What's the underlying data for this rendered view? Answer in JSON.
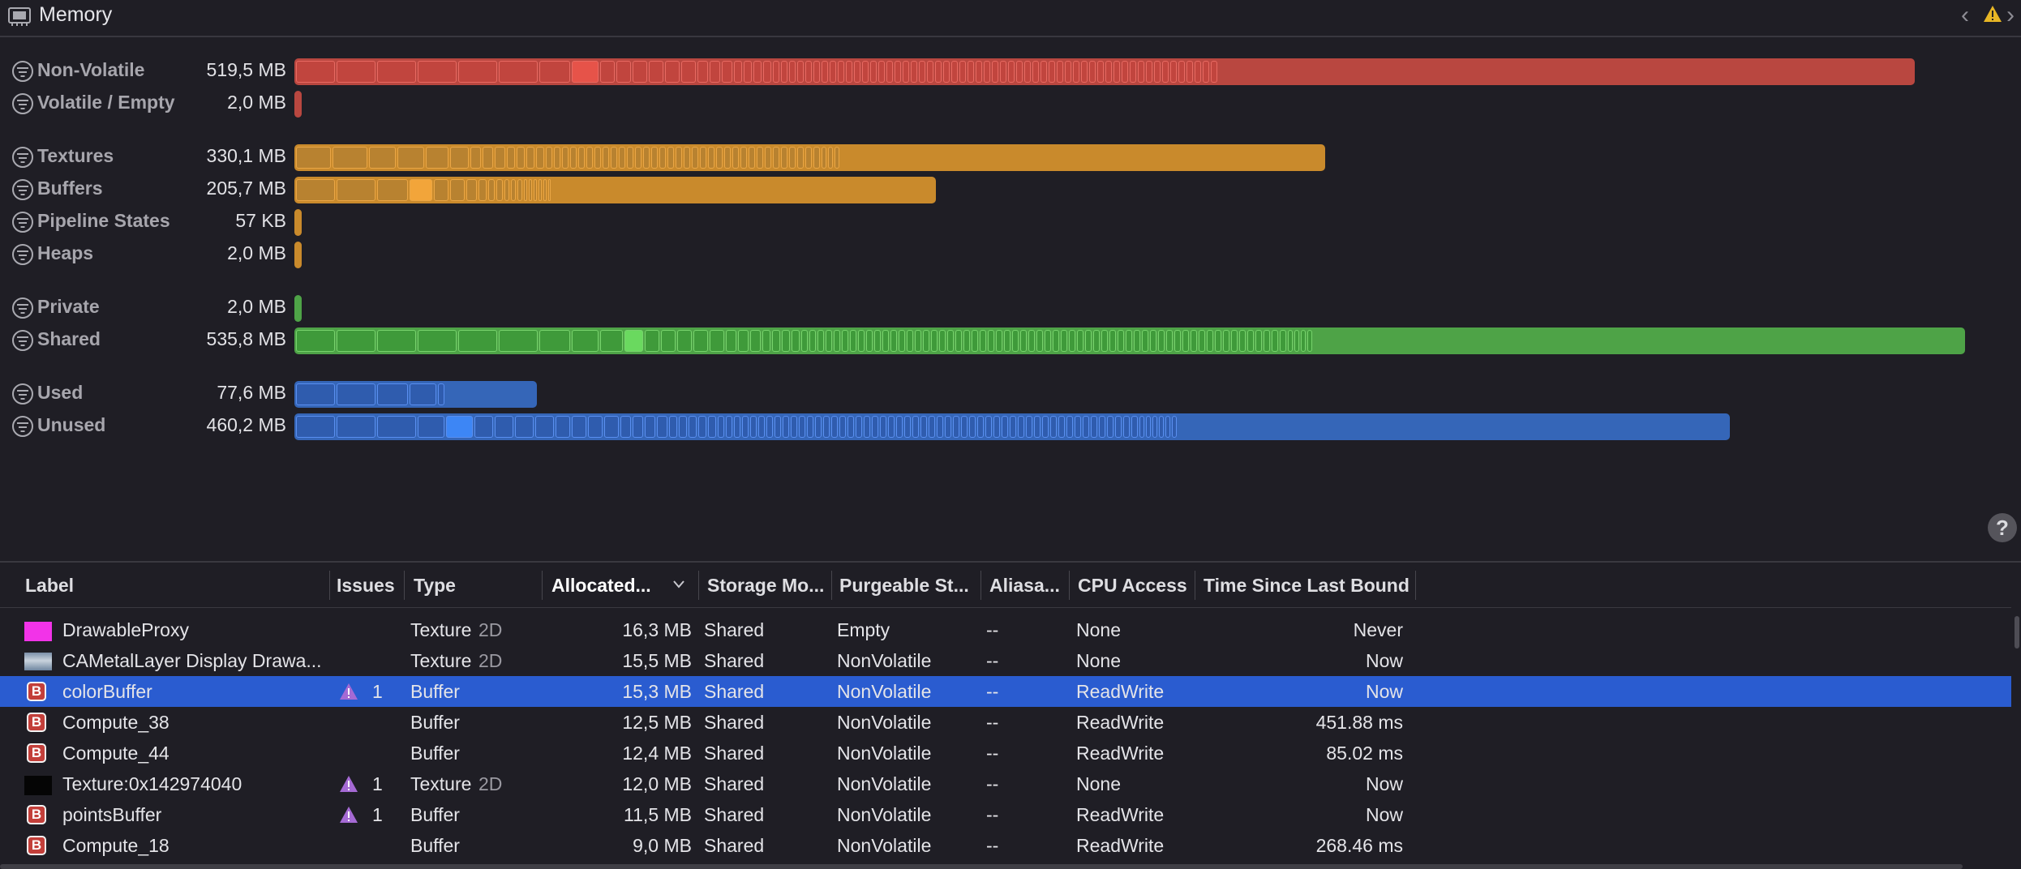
{
  "window": {
    "title": "Memory",
    "back_icon": "chevron-left-icon",
    "forward_icon": "chevron-right-icon",
    "issue_icon": "warning-icon"
  },
  "memory_rows": [
    {
      "key": "nonvolatile",
      "label": "Non-Volatile",
      "size": "519,5 MB",
      "bar_fraction": 0.97,
      "color": "#b94740",
      "segments": [
        50,
        50,
        50,
        50,
        50,
        50,
        40,
        35,
        20,
        20,
        20,
        20,
        20,
        20,
        15,
        15,
        15,
        12,
        12,
        12,
        12,
        10,
        10,
        10,
        10,
        10,
        10,
        10,
        10,
        10,
        10,
        10,
        10,
        10,
        10,
        10,
        10,
        10,
        10,
        10,
        10,
        10,
        10,
        10,
        10,
        10,
        10,
        10,
        10,
        10,
        10,
        10,
        10,
        10,
        10,
        10,
        10,
        10,
        10,
        10,
        10,
        10,
        10,
        10,
        10,
        10,
        10,
        10,
        10,
        10,
        10,
        10,
        10,
        10,
        10,
        10
      ],
      "highlight": 7
    },
    {
      "key": "volatile",
      "label": "Volatile / Empty",
      "size": "2,0 MB",
      "bar_fraction": 0.004,
      "color": "#b94740",
      "segments": [],
      "highlight": -1
    },
    {
      "key": "textures",
      "label": "Textures",
      "size": "330,1 MB",
      "bar_fraction": 0.617,
      "color": "#c98a2c",
      "segments": [
        45,
        45,
        35,
        35,
        30,
        25,
        15,
        15,
        15,
        12,
        12,
        12,
        12,
        10,
        10,
        10,
        10,
        10,
        10,
        10,
        10,
        10,
        10,
        10,
        10,
        10,
        10,
        10,
        10,
        10,
        10,
        10,
        10,
        10,
        10,
        10,
        10,
        10,
        10,
        10,
        10,
        10,
        10,
        10,
        10,
        10,
        10,
        8,
        8,
        8
      ],
      "highlight": -1
    },
    {
      "key": "buffers",
      "label": "Buffers",
      "size": "205,7 MB",
      "bar_fraction": 0.384,
      "color": "#c98a2c",
      "segments": [
        50,
        50,
        40,
        30,
        20,
        20,
        15,
        12,
        10,
        10,
        8,
        8,
        8,
        6,
        6,
        6,
        6,
        6,
        5
      ],
      "highlight": 3
    },
    {
      "key": "pipeline",
      "label": "Pipeline States",
      "size": "57 KB",
      "bar_fraction": 0.004,
      "color": "#c98a2c",
      "segments": [],
      "highlight": -1
    },
    {
      "key": "heaps",
      "label": "Heaps",
      "size": "2,0 MB",
      "bar_fraction": 0.004,
      "color": "#c98a2c",
      "segments": [],
      "highlight": -1
    },
    {
      "key": "private",
      "label": "Private",
      "size": "2,0 MB",
      "bar_fraction": 0.004,
      "color": "#4ea347",
      "segments": [],
      "highlight": -1
    },
    {
      "key": "shared",
      "label": "Shared",
      "size": "535,8 MB",
      "bar_fraction": 1.0,
      "color": "#4ea347",
      "segments": [
        50,
        50,
        50,
        50,
        50,
        50,
        40,
        35,
        30,
        25,
        20,
        20,
        20,
        20,
        20,
        15,
        15,
        15,
        12,
        12,
        12,
        12,
        10,
        10,
        10,
        10,
        10,
        10,
        10,
        10,
        10,
        10,
        10,
        10,
        10,
        10,
        10,
        10,
        10,
        10,
        10,
        10,
        10,
        10,
        10,
        10,
        10,
        10,
        10,
        10,
        10,
        10,
        10,
        10,
        10,
        10,
        10,
        10,
        10,
        10,
        10,
        10,
        10,
        10,
        10,
        10,
        10,
        10,
        10,
        10,
        10,
        10,
        10,
        10,
        10,
        10,
        10,
        10,
        10,
        10,
        10,
        10,
        8,
        8,
        8,
        8
      ],
      "highlight": 9
    },
    {
      "key": "used",
      "label": "Used",
      "size": "77,6 MB",
      "bar_fraction": 0.145,
      "color": "#3566b8",
      "segments": [
        50,
        50,
        40,
        35,
        10
      ],
      "highlight": -1
    },
    {
      "key": "unused",
      "label": "Unused",
      "size": "460,2 MB",
      "bar_fraction": 0.859,
      "color": "#3566b8",
      "segments": [
        50,
        50,
        50,
        35,
        35,
        25,
        25,
        25,
        25,
        20,
        20,
        20,
        20,
        15,
        15,
        15,
        15,
        12,
        12,
        12,
        12,
        12,
        10,
        10,
        10,
        10,
        10,
        10,
        10,
        10,
        10,
        10,
        10,
        10,
        10,
        10,
        10,
        10,
        10,
        10,
        10,
        10,
        10,
        10,
        10,
        10,
        10,
        10,
        10,
        10,
        10,
        10,
        10,
        10,
        10,
        10,
        10,
        10,
        10,
        10,
        10,
        10,
        10,
        10,
        10,
        10,
        10,
        10,
        10,
        10,
        10,
        10,
        10,
        10,
        8,
        8,
        8,
        8,
        8,
        8
      ],
      "highlight": 4
    }
  ],
  "table": {
    "columns": [
      "Label",
      "Issues",
      "Type",
      "Allocated...",
      "Storage Mo...",
      "Purgeable St...",
      "Aliasa...",
      "CPU Access",
      "Time Since Last Bound"
    ],
    "sorted_column": "Allocated...",
    "rows": [
      {
        "icon": "magenta-swatch-icon",
        "label": "DrawableProxy",
        "issue_icon": "",
        "issues": "",
        "type": "Texture",
        "type_dim": "2D",
        "allocated": "16,3 MB",
        "storage": "Shared",
        "purgeable": "Empty",
        "aliasable": "--",
        "cpu": "None",
        "time": "Never",
        "selected": false
      },
      {
        "icon": "image-thumbnail-icon",
        "label": "CAMetalLayer Display Drawa...",
        "issue_icon": "",
        "issues": "",
        "type": "Texture",
        "type_dim": "2D",
        "allocated": "15,5 MB",
        "storage": "Shared",
        "purgeable": "NonVolatile",
        "aliasable": "--",
        "cpu": "None",
        "time": "Now",
        "selected": false
      },
      {
        "icon": "buffer-icon",
        "label": "colorBuffer",
        "issue_icon": "warning-icon",
        "issues": "1",
        "type": "Buffer",
        "type_dim": "",
        "allocated": "15,3 MB",
        "storage": "Shared",
        "purgeable": "NonVolatile",
        "aliasable": "--",
        "cpu": "ReadWrite",
        "time": "Now",
        "selected": true
      },
      {
        "icon": "buffer-icon",
        "label": "Compute_38",
        "issue_icon": "",
        "issues": "",
        "type": "Buffer",
        "type_dim": "",
        "allocated": "12,5 MB",
        "storage": "Shared",
        "purgeable": "NonVolatile",
        "aliasable": "--",
        "cpu": "ReadWrite",
        "time": "451.88 ms",
        "selected": false
      },
      {
        "icon": "buffer-icon",
        "label": "Compute_44",
        "issue_icon": "",
        "issues": "",
        "type": "Buffer",
        "type_dim": "",
        "allocated": "12,4 MB",
        "storage": "Shared",
        "purgeable": "NonVolatile",
        "aliasable": "--",
        "cpu": "ReadWrite",
        "time": "85.02 ms",
        "selected": false
      },
      {
        "icon": "black-swatch-icon",
        "label": "Texture:0x142974040",
        "issue_icon": "warning-icon",
        "issues": "1",
        "type": "Texture",
        "type_dim": "2D",
        "allocated": "12,0 MB",
        "storage": "Shared",
        "purgeable": "NonVolatile",
        "aliasable": "--",
        "cpu": "None",
        "time": "Now",
        "selected": false
      },
      {
        "icon": "buffer-icon",
        "label": "pointsBuffer",
        "issue_icon": "warning-icon",
        "issues": "1",
        "type": "Buffer",
        "type_dim": "",
        "allocated": "11,5 MB",
        "storage": "Shared",
        "purgeable": "NonVolatile",
        "aliasable": "--",
        "cpu": "ReadWrite",
        "time": "Now",
        "selected": false
      },
      {
        "icon": "buffer-icon",
        "label": "Compute_18",
        "issue_icon": "",
        "issues": "",
        "type": "Buffer",
        "type_dim": "",
        "allocated": "9,0 MB",
        "storage": "Shared",
        "purgeable": "NonVolatile",
        "aliasable": "--",
        "cpu": "ReadWrite",
        "time": "268.46 ms",
        "selected": false
      }
    ]
  },
  "help_label": "?",
  "buffer_glyph": "B"
}
